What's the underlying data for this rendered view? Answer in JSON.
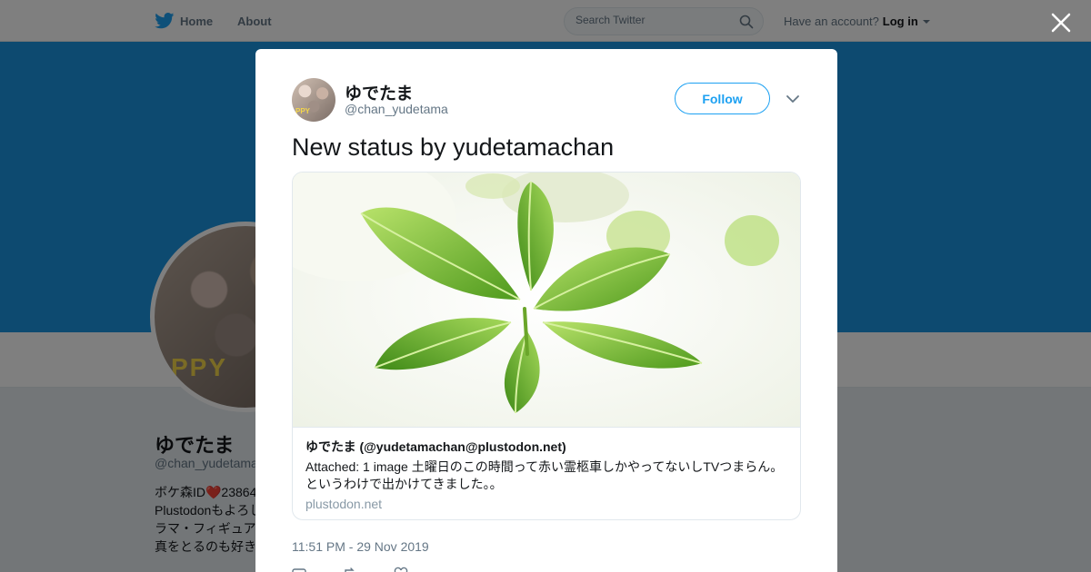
{
  "topbar": {
    "home_label": "Home",
    "about_label": "About",
    "search_placeholder": "Search Twitter",
    "account_prompt": "Have an account?",
    "login_label": "Log in"
  },
  "profile": {
    "name": "ゆでたま",
    "handle": "@chan_yudetama",
    "bio_lines": [
      "ボケ森ID❤️23864",
      "Plustodonもよろし",
      "ラマ・フィギュア",
      "真をとるのも好き"
    ]
  },
  "tweet": {
    "author_name": "ゆでたま",
    "author_handle": "@chan_yudetama",
    "follow_label": "Follow",
    "text": "New status by yudetamachan",
    "card": {
      "title": "ゆでたま (@yudetamachan@plustodon.net)",
      "description": "Attached: 1 image 土曜日のこの時間って赤い霊柩車しかやってないしTVつまらん。というわけで出かけてきました。。",
      "domain": "plustodon.net"
    },
    "timestamp": "11:51 PM - 29 Nov 2019"
  },
  "colors": {
    "brand": "#1da1f2",
    "banner": "#1b95e0",
    "muted": "#657786"
  },
  "icons": [
    "twitter-bird-icon",
    "search-icon",
    "caret-down-icon",
    "close-icon",
    "chevron-down-icon",
    "reply-icon",
    "retweet-icon",
    "like-icon"
  ]
}
